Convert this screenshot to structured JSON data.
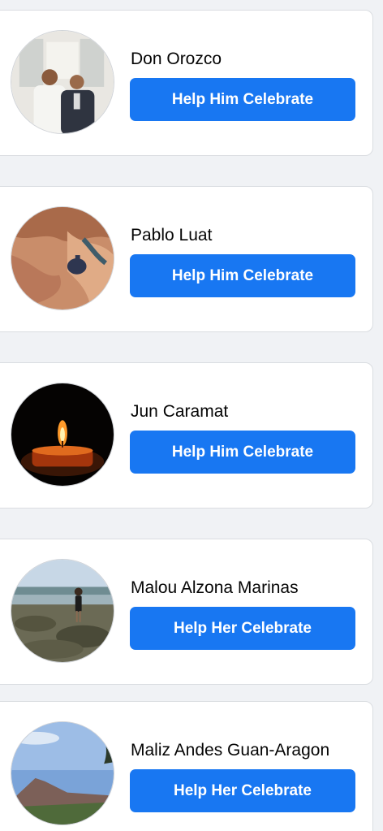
{
  "colors": {
    "background": "#f0f2f5",
    "card": "#ffffff",
    "accent": "#1877f2",
    "button_text": "#ffffff",
    "name_text": "#050505"
  },
  "people": [
    {
      "name": "Don Orozco",
      "button_label": "Help Him Celebrate",
      "avatar_icon": "two-men-photo"
    },
    {
      "name": "Pablo Luat",
      "button_label": "Help Him Celebrate",
      "avatar_icon": "canyon-photo"
    },
    {
      "name": "Jun Caramat",
      "button_label": "Help Him Celebrate",
      "avatar_icon": "candle-photo"
    },
    {
      "name": "Malou Alzona Marinas",
      "button_label": "Help Her Celebrate",
      "avatar_icon": "rocky-shore-photo"
    },
    {
      "name": "Maliz Andes Guan-Aragon",
      "button_label": "Help Her Celebrate",
      "avatar_icon": "mountain-photo"
    }
  ]
}
